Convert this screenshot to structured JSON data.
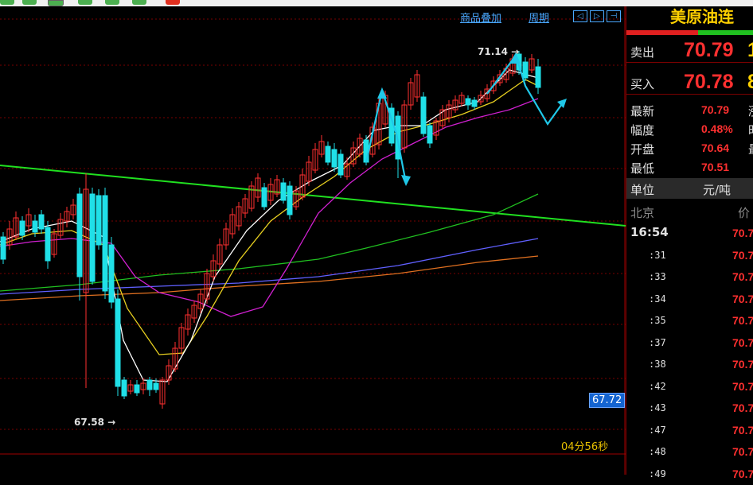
{
  "toolbar": {
    "buttons": [
      "tool-1",
      "tool-2",
      "tool-3",
      "tool-4",
      "tool-5",
      "tool-6",
      "tool-7"
    ]
  },
  "chart": {
    "links": {
      "overlay": "商品叠加",
      "period": "周期"
    },
    "nav_icons": [
      "◁",
      "▷",
      "⊣"
    ],
    "high_label": "71.14",
    "low_label": "67.58",
    "last_price_tag": "67.72",
    "countdown": "04分56秒",
    "colors": {
      "up": "#ff3030",
      "down": "#20e0e8",
      "trendline": "#20e020",
      "ma5": "#ffffff",
      "ma10": "#e8d020",
      "ma20": "#d020d0",
      "ma60": "#20c020",
      "ma120": "#6060ff",
      "ma250": "#e07020",
      "annotation": "#20c8e8"
    }
  },
  "panel": {
    "title": "美原油连",
    "sell_label": "卖出",
    "sell_price": "70.79",
    "buy_label": "买入",
    "buy_price": "70.78",
    "stats": [
      {
        "label": "最新",
        "value": "70.79",
        "edge": "涨"
      },
      {
        "label": "幅度",
        "value": "0.48%",
        "edge": "时"
      },
      {
        "label": "开盘",
        "value": "70.64",
        "edge": "最"
      },
      {
        "label": "最低",
        "value": "70.51",
        "edge": ""
      }
    ],
    "unit_label": "单位",
    "unit_value": "元/吨",
    "tick_city": "北京",
    "tick_col": "价",
    "ticks": [
      {
        "time": "16:54",
        "price": "70.7"
      },
      {
        "time": ":31",
        "price": "70.7"
      },
      {
        "time": ":33",
        "price": "70.7"
      },
      {
        "time": ":34",
        "price": "70.7"
      },
      {
        "time": ":35",
        "price": "70.7"
      },
      {
        "time": ":37",
        "price": "70.7"
      },
      {
        "time": ":38",
        "price": "70.7"
      },
      {
        "time": ":42",
        "price": "70.7"
      },
      {
        "time": ":43",
        "price": "70.7"
      },
      {
        "time": ":47",
        "price": "70.7"
      },
      {
        "time": ":48",
        "price": "70.7"
      },
      {
        "time": ":49",
        "price": "70.7"
      }
    ]
  }
}
